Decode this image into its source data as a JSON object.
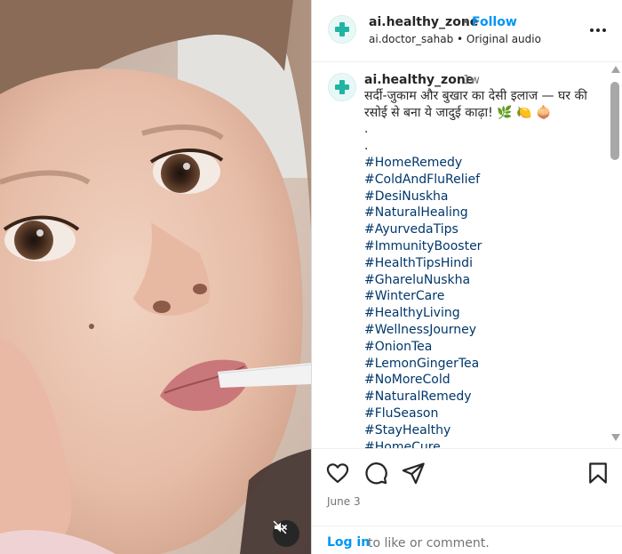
{
  "post": {
    "username": "ai.healthy_zone",
    "separator": "•",
    "follow_label": "Follow",
    "subtitle": "ai.doctor_sahab • Original audio",
    "more_icon": "more-options-icon",
    "avatar_icon": "medical-cross-icon"
  },
  "caption": {
    "username": "ai.healthy_zone",
    "time": "1w",
    "text": "सर्दी-जुकाम और बुखार का देसी इलाज — घर की रसोई से बना ये जादुई काढ़ा! 🌿 🍋 🧅",
    "dot1": ".",
    "dot2": ".",
    "hashtags": [
      "#HomeRemedy",
      "#ColdAndFluRelief",
      "#DesiNuskha",
      "#NaturalHealing",
      "#AyurvedaTips",
      "#ImmunityBooster",
      "#HealthTipsHindi",
      "#GhareluNuskha",
      "#WinterCare",
      "#HealthyLiving",
      "#WellnessJourney",
      "#OnionTea",
      "#LemonGingerTea",
      "#NoMoreCold",
      "#NaturalRemedy",
      "#FluSeason",
      "#StayHealthy",
      "#HomeCure"
    ]
  },
  "actions": {
    "icons": [
      "heart-icon",
      "comment-icon",
      "share-icon",
      "bookmark-icon"
    ],
    "date": "June 3",
    "login_link": "Log in",
    "login_rest": "to like or comment."
  },
  "media": {
    "mute_icon": "speaker-muted-icon"
  },
  "colors": {
    "accent": "#0095f6",
    "hashtag": "#00376b",
    "muted": "#737373",
    "avatar_cross": "#1fb5a3"
  }
}
